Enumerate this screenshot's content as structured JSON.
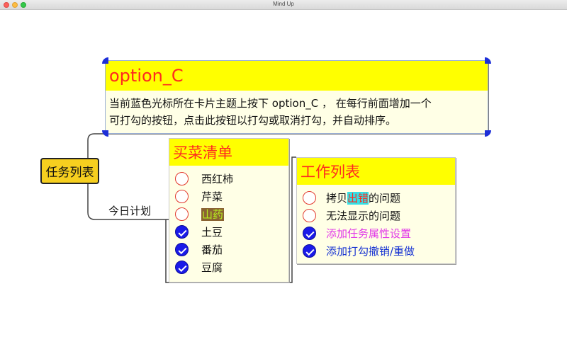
{
  "window": {
    "title": "Mind Up"
  },
  "root": {
    "label": "任务列表"
  },
  "edge_label": "今日计划",
  "option_card": {
    "title": "option_C",
    "desc_line1": "当前蓝色光标所在卡片主题上按下 option_C ， 在每行前面增加一个",
    "desc_line2": "可打勾的按钮，点击此按钮以打勾或取消打勾，并自动排序。"
  },
  "shopping_card": {
    "title": "买菜清单",
    "items": [
      {
        "text": "西红柿",
        "checked": false
      },
      {
        "text": "芹菜",
        "checked": false
      },
      {
        "text": "山药",
        "checked": false
      },
      {
        "text": "土豆",
        "checked": true
      },
      {
        "text": "番茄",
        "checked": true
      },
      {
        "text": "豆腐",
        "checked": true
      }
    ]
  },
  "work_card": {
    "title": "工作列表",
    "items": [
      {
        "pre": "拷贝",
        "highlight": "出错",
        "post": "的问题",
        "checked": false
      },
      {
        "text": "无法显示的问题",
        "checked": false
      },
      {
        "text": "添加任务属性设置",
        "checked": true
      },
      {
        "text": "添加打勾撤销/重做",
        "checked": true
      }
    ]
  },
  "colors": {
    "title_bg": "#ffff00",
    "title_text": "#ff2a1f",
    "card_bg": "#ffffe6",
    "root_bg": "#f6cf1f",
    "check_fill": "#1a1ae8",
    "selection_handle": "#1d2fd8"
  }
}
